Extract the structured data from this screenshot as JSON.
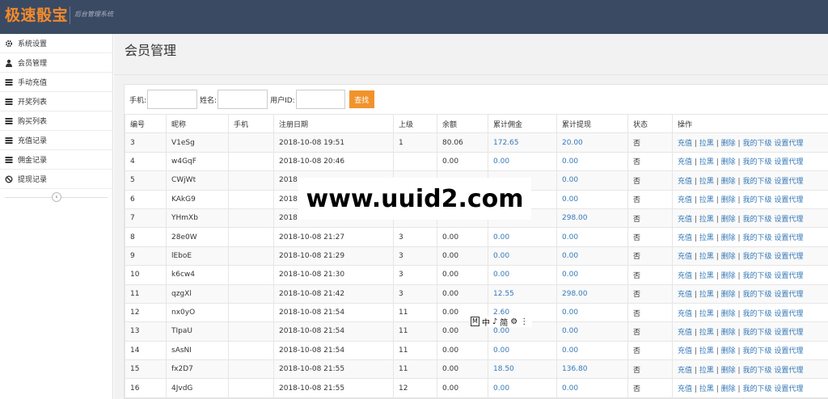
{
  "header": {
    "brand": "极速骰宝",
    "subtitle": "后台管理系统"
  },
  "sidebar": {
    "items": [
      {
        "label": "系统设置",
        "icon": "gear-icon"
      },
      {
        "label": "会员管理",
        "icon": "user-icon"
      },
      {
        "label": "手动充值",
        "icon": "list-icon"
      },
      {
        "label": "开奖列表",
        "icon": "list-icon"
      },
      {
        "label": "购买列表",
        "icon": "list-icon"
      },
      {
        "label": "充值记录",
        "icon": "list-icon"
      },
      {
        "label": "佣金记录",
        "icon": "list-icon"
      },
      {
        "label": "提现记录",
        "icon": "ban-icon"
      }
    ],
    "collapse_symbol": "‹"
  },
  "page": {
    "title": "会员管理"
  },
  "search": {
    "phone_label": "手机:",
    "name_label": "姓名:",
    "uid_label": "用户ID:",
    "button": "查找"
  },
  "table": {
    "columns": [
      "编号",
      "昵称",
      "手机",
      "注册日期",
      "上级",
      "余额",
      "累计佣金",
      "累计提现",
      "状态",
      "操作"
    ],
    "rows": [
      [
        "3",
        "V1eSg",
        "",
        "2018-10-08 19:51",
        "1",
        "80.06",
        "172.65",
        "20.00",
        "否"
      ],
      [
        "4",
        "w4GqF",
        "",
        "2018-10-08 20:46",
        "",
        "0.00",
        "0.00",
        "0.00",
        "否"
      ],
      [
        "5",
        "CWjWt",
        "",
        "2018",
        "",
        "",
        "",
        "0.00",
        "否"
      ],
      [
        "6",
        "KAkG9",
        "",
        "2018",
        "",
        "",
        "",
        "0.00",
        "否"
      ],
      [
        "7",
        "YHmXb",
        "",
        "2018",
        "",
        "",
        "",
        "298.00",
        "否"
      ],
      [
        "8",
        "28e0W",
        "",
        "2018-10-08 21:27",
        "3",
        "0.00",
        "0.00",
        "0.00",
        "否"
      ],
      [
        "9",
        "lEboE",
        "",
        "2018-10-08 21:29",
        "3",
        "0.00",
        "0.00",
        "0.00",
        "否"
      ],
      [
        "10",
        "k6cw4",
        "",
        "2018-10-08 21:30",
        "3",
        "0.00",
        "0.00",
        "0.00",
        "否"
      ],
      [
        "11",
        "qzgXl",
        "",
        "2018-10-08 21:42",
        "3",
        "0.00",
        "12.55",
        "298.00",
        "否"
      ],
      [
        "12",
        "nx0yO",
        "",
        "2018-10-08 21:54",
        "11",
        "0.00",
        "2.60",
        "0.00",
        "否"
      ],
      [
        "13",
        "TIpaU",
        "",
        "2018-10-08 21:54",
        "11",
        "0.00",
        "0.00",
        "0.00",
        "否"
      ],
      [
        "14",
        "sAsNI",
        "",
        "2018-10-08 21:54",
        "11",
        "0.00",
        "0.00",
        "0.00",
        "否"
      ],
      [
        "15",
        "fx2D7",
        "",
        "2018-10-08 21:55",
        "11",
        "0.00",
        "18.50",
        "136.80",
        "否"
      ],
      [
        "16",
        "4JvdG",
        "",
        "2018-10-08 21:55",
        "12",
        "0.00",
        "0.00",
        "0.00",
        "否"
      ]
    ],
    "actions": [
      "充值",
      "拉黑",
      "删除",
      "我的下级",
      "设置代理"
    ],
    "action_sep": "|"
  },
  "watermark": {
    "text": "www.uuid2.com"
  },
  "ime_bar": {
    "items": [
      "M",
      "中",
      "♪",
      "简",
      "⚙",
      "⋮"
    ]
  },
  "colors": {
    "header_bg": "#3a4a62",
    "brand": "#f38a2c",
    "search_button": "#f0932c",
    "link": "#3478b8"
  }
}
